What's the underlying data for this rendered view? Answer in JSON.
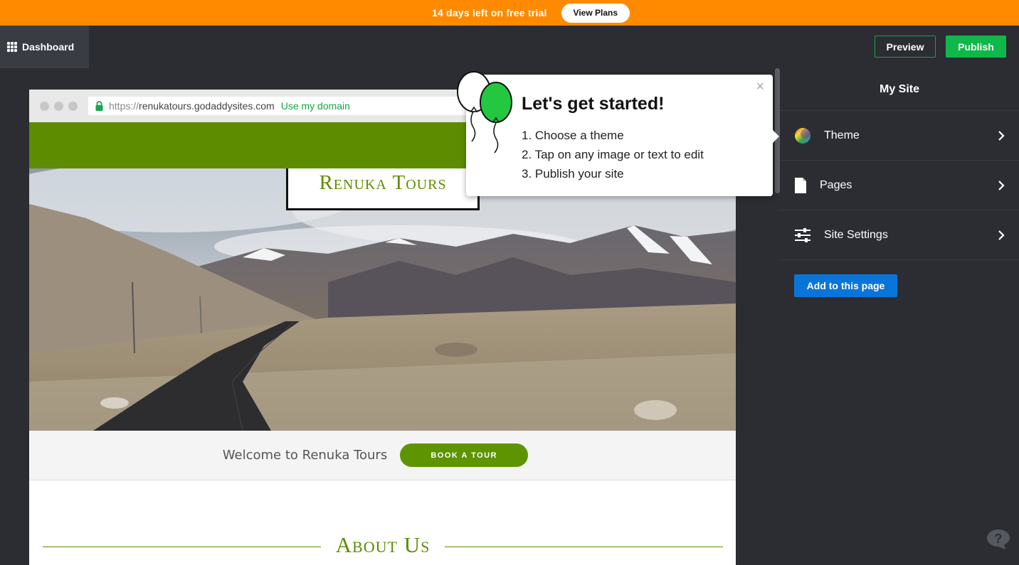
{
  "trial_banner": {
    "text": "14 days left on free trial",
    "button": "View Plans",
    "color": "#ff8a00"
  },
  "topnav": {
    "dashboard_label": "Dashboard",
    "preview_label": "Preview",
    "publish_label": "Publish"
  },
  "browser": {
    "url_protocol": "https://",
    "url_host": "renukatours.godaddysites.com",
    "use_domain_link": "Use my domain"
  },
  "site": {
    "logo": "Renuka Tours",
    "welcome_text": "Welcome to Renuka Tours",
    "book_button": "BOOK A TOUR",
    "about_heading": "About Us",
    "brand_color": "#5d8c00"
  },
  "popover": {
    "title": "Let's get started!",
    "steps": [
      "1. Choose a theme",
      "2. Tap on any image or text to edit",
      "3. Publish your site"
    ],
    "close": "×"
  },
  "sidebar": {
    "title": "My Site",
    "items": [
      {
        "label": "Theme",
        "icon": "color-wheel-icon"
      },
      {
        "label": "Pages",
        "icon": "page-icon"
      },
      {
        "label": "Site Settings",
        "icon": "sliders-icon"
      }
    ],
    "add_button": "Add to this page"
  }
}
